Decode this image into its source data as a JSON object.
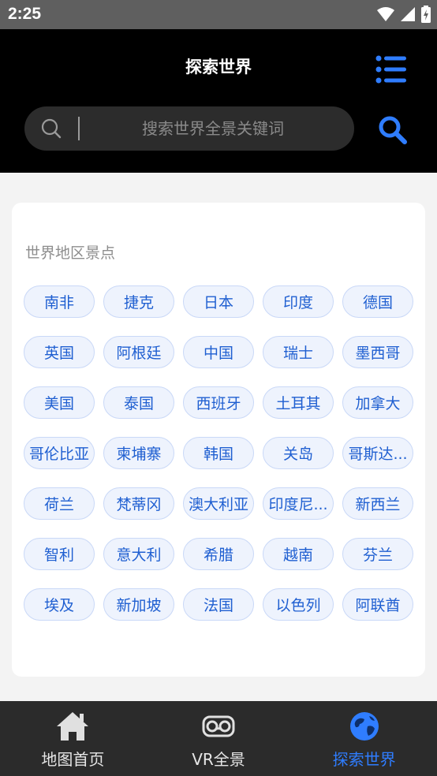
{
  "status_bar": {
    "time": "2:25"
  },
  "header": {
    "title": "探索世界"
  },
  "search": {
    "placeholder": "搜索世界全景关键词"
  },
  "section": {
    "title": "世界地区景点",
    "tags": [
      "南非",
      "捷克",
      "日本",
      "印度",
      "德国",
      "英国",
      "阿根廷",
      "中国",
      "瑞士",
      "墨西哥",
      "美国",
      "泰国",
      "西班牙",
      "土耳其",
      "加拿大",
      "哥伦比亚",
      "柬埔寨",
      "韩国",
      "关岛",
      "哥斯达...",
      "荷兰",
      "梵蒂冈",
      "澳大利亚",
      "印度尼...",
      "新西兰",
      "智利",
      "意大利",
      "希腊",
      "越南",
      "芬兰",
      "埃及",
      "新加坡",
      "法国",
      "以色列",
      "阿联酋"
    ]
  },
  "bottom_nav": {
    "items": [
      {
        "label": "地图首页",
        "icon": "home-icon"
      },
      {
        "label": "VR全景",
        "icon": "vr-headset-icon"
      },
      {
        "label": "探索世界",
        "icon": "globe-icon",
        "active": true
      }
    ]
  },
  "colors": {
    "accent": "#2f7dff",
    "tag_text": "#1f5fd1",
    "tag_bg": "#eef3fd",
    "header_bg": "#000000"
  }
}
